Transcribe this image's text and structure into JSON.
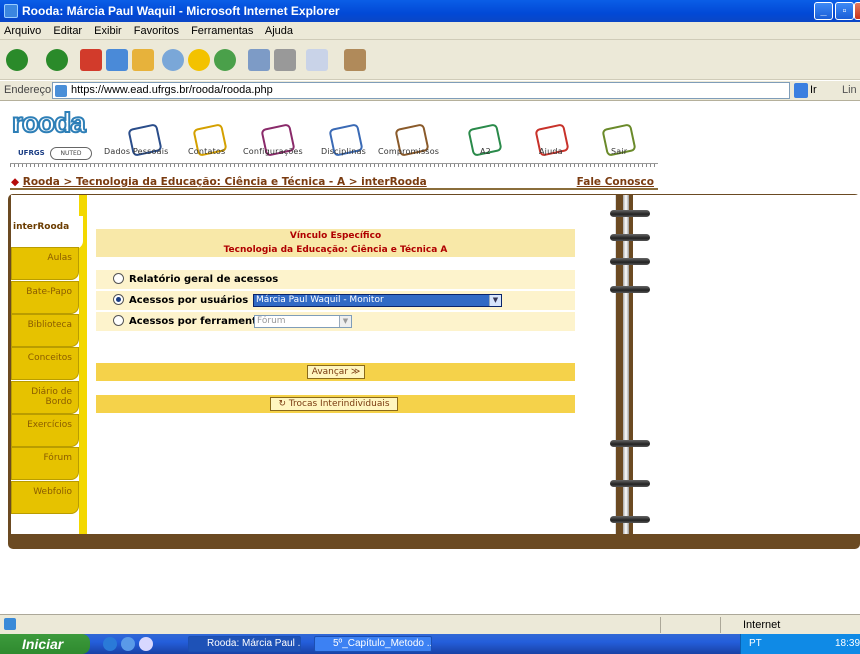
{
  "window": {
    "title": "Rooda: Márcia Paul Waquil - Microsoft Internet Explorer"
  },
  "menu": [
    "Arquivo",
    "Editar",
    "Exibir",
    "Favoritos",
    "Ferramentas",
    "Ajuda"
  ],
  "address": {
    "label": "Endereço",
    "url": "https://www.ead.ufrgs.br/rooda/rooda.php",
    "go": "Ir",
    "links": "Lin"
  },
  "brand": {
    "logo": "rooda",
    "ufrgs": "UFRGS",
    "nuted": "NUTED"
  },
  "topnav": [
    "Dados Pessoais",
    "Contatos",
    "Configurações",
    "Disciplinas",
    "Compromissos",
    "A2",
    "Ajuda",
    "Sair"
  ],
  "breadcrumb": {
    "path": "Rooda > Tecnologia da Educação: Ciência e Técnica - A > interRooda",
    "fale": "Fale Conosco"
  },
  "tabs": [
    "interRooda",
    "Aulas",
    "Bate-Papo",
    "Biblioteca",
    "Conceitos",
    "Diário de Bordo",
    "Exercícios",
    "Fórum",
    "Webfolio"
  ],
  "panel": {
    "heading": "Vínculo Específico",
    "subheading": "Tecnologia da Educação: Ciência e Técnica A",
    "option1": "Relatório geral de acessos",
    "option2": "Acessos por usuários",
    "option2_value": "Márcia Paul Waquil - Monitor",
    "option3": "Acessos por ferramenta",
    "option3_value": "Fórum",
    "advance": "Avançar ≫",
    "trocas": "Trocas Interindividuais"
  },
  "status": {
    "zone": "Internet"
  },
  "taskbar": {
    "start": "Iniciar",
    "tasks": [
      "Rooda: Márcia Paul ...",
      "5º_Capítulo_Metodo ..."
    ],
    "lang": "PT",
    "clock": "18:39"
  },
  "colors": {
    "accent": "#f3d800",
    "tab": "#e6c200",
    "notebook": "#6b4a22",
    "header_text": "#b00000"
  }
}
